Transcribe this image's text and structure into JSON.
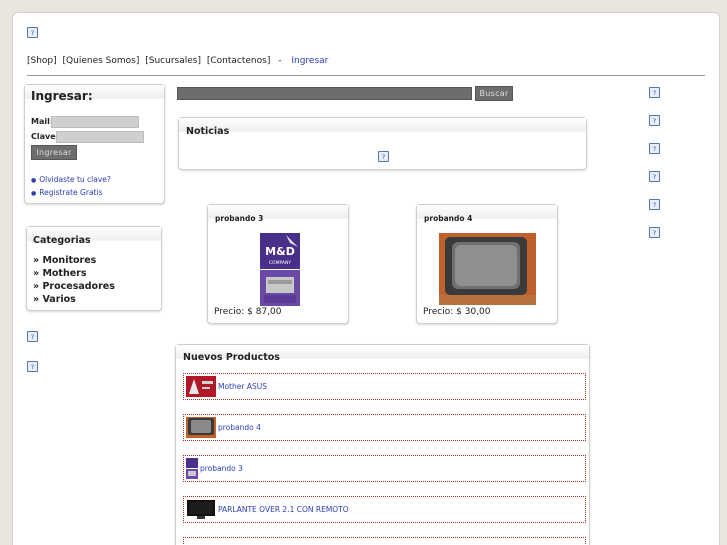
{
  "nav": {
    "shop": "[Shop]",
    "about": "[Quienes Somos]",
    "branches": "[Sucursales]",
    "contact": "[Contactenos]",
    "separator": "-",
    "login": "Ingresar"
  },
  "login_box": {
    "title": "Ingresar:",
    "mail_label": "Mail:",
    "password_label": "Clave:",
    "submit_label": "Ingresar",
    "forgot_link": "Olvidaste tu clave?",
    "register_link": "Registrate Gratis"
  },
  "categories": {
    "title": "Categorias",
    "items": [
      "» Monitores",
      "» Mothers",
      "» Procesadores",
      "» Varios"
    ]
  },
  "search": {
    "button_label": "Buscar"
  },
  "news": {
    "title": "Noticias"
  },
  "featured_products": [
    {
      "name": "probando 3",
      "price": "Precio:  $ 87,00",
      "thumb_icon": "md-company-product-image"
    },
    {
      "name": "probando 4",
      "price": "Precio:  $ 30,00",
      "thumb_icon": "crt-monitor-image"
    }
  ],
  "new_products": {
    "title": "Nuevos Productos",
    "items": [
      {
        "label": "Mother ASUS",
        "thumb_icon": "motherboard-image"
      },
      {
        "label": "probando 4",
        "thumb_icon": "crt-monitor-image"
      },
      {
        "label": "probando 3",
        "thumb_icon": "md-company-product-image"
      },
      {
        "label": "PARLANTE OVER 2.1 CON REMOTO",
        "thumb_icon": "flat-monitor-image"
      }
    ]
  },
  "broken_image_icon": "broken-image-icon",
  "colors": {
    "link": "#2a3fb0",
    "button": "#6d6d6d",
    "background": "#e8e6df"
  }
}
